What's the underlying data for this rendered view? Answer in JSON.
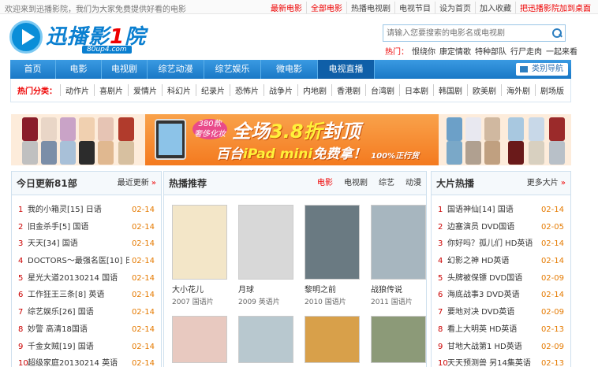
{
  "topbar": {
    "welcome": "欢迎来到迅播影院，我们为大家免费提供好看的电影",
    "links": [
      {
        "label": "最新电影",
        "color": "red"
      },
      {
        "label": "全部电影",
        "color": "red"
      },
      {
        "label": "热播电视剧",
        "color": "dark"
      },
      {
        "label": "电视节目",
        "color": "dark"
      },
      {
        "label": "设为首页",
        "color": "dark"
      },
      {
        "label": "加入收藏",
        "color": "dark"
      },
      {
        "label": "把迅播影院加到桌面",
        "color": "red"
      }
    ]
  },
  "logo": {
    "name_a": "迅播影",
    "name_one": "1",
    "name_b": "院",
    "sub": "80up4.com"
  },
  "search": {
    "placeholder": "请输入您要搜索的电影名或电视剧"
  },
  "hot": {
    "label": "热门：",
    "items": [
      "恨绕你",
      "康定情歌",
      "特种部队",
      "行尸走肉",
      "一起来看"
    ]
  },
  "nav": {
    "items": [
      "首页",
      "电影",
      "电视剧",
      "综艺动漫",
      "综艺娱乐",
      "微电影",
      "电视直播"
    ],
    "active_index": 6,
    "menu_label": "类别导航"
  },
  "subnav": {
    "label": "热门分类：",
    "items": [
      "动作片",
      "喜剧片",
      "爱情片",
      "科幻片",
      "纪录片",
      "恐怖片",
      "战争片",
      "内地剧",
      "香港剧",
      "台湾剧",
      "日本剧",
      "韩国剧",
      "欧美剧",
      "海外剧",
      "剧场版"
    ]
  },
  "banner": {
    "tag_line1": "380款",
    "tag_line2": "奢侈化妆",
    "headline_a": "全场",
    "headline_num": "3.8折",
    "headline_b": "封顶",
    "subline_a": "百台",
    "subline_b": "iPad mini",
    "subline_c": "免费拿！",
    "auth": "100%正行货"
  },
  "left_col": {
    "title": "今日更新81部",
    "more": "最近更新",
    "items": [
      {
        "n": "1",
        "title": "我的小箱灵[15] 日语",
        "date": "02-14"
      },
      {
        "n": "2",
        "title": "旧金杀手[5] 国语",
        "date": "02-14"
      },
      {
        "n": "3",
        "title": "天天[34] 国语",
        "date": "02-14"
      },
      {
        "n": "4",
        "title": "DOCTORS～最强名医[10] 日语",
        "date": "02-14"
      },
      {
        "n": "5",
        "title": "星光大道20130214 国语",
        "date": "02-14"
      },
      {
        "n": "6",
        "title": "工作狂王三条[8] 英语",
        "date": "02-14"
      },
      {
        "n": "7",
        "title": "综艺娱乐[26] 国语",
        "date": "02-14"
      },
      {
        "n": "8",
        "title": "妙警 高清18国语",
        "date": "02-14"
      },
      {
        "n": "9",
        "title": "千金女贼[19] 国语",
        "date": "02-14"
      },
      {
        "n": "10",
        "title": "超级家庭20130214 英语",
        "date": "02-14"
      }
    ]
  },
  "mid_col": {
    "title": "热播推荐",
    "tabs": [
      "电影",
      "电视剧",
      "综艺",
      "动漫"
    ],
    "active_tab": 0,
    "movies_row1": [
      {
        "title": "大小花儿",
        "info": "2007 国语片",
        "bg": "#f3e6c8"
      },
      {
        "title": "月球",
        "info": "2009 英语片",
        "bg": "#d8d8d8"
      },
      {
        "title": "黎明之前",
        "info": "2010 国语片",
        "bg": "#6a7a82"
      },
      {
        "title": "战狼传说",
        "info": "2011 国语片",
        "bg": "#a7b6bf"
      }
    ],
    "movies_row2": [
      {
        "bg": "#e8c9c0"
      },
      {
        "bg": "#b8c8cf"
      },
      {
        "bg": "#d8a04a"
      },
      {
        "bg": "#8c9a78"
      }
    ]
  },
  "right_col": {
    "title": "大片热播",
    "more": "更多大片",
    "items": [
      {
        "n": "1",
        "title": "国语神仙[14] 国语",
        "date": "02-14"
      },
      {
        "n": "2",
        "title": "边塞演员 DVD国语",
        "date": "02-05"
      },
      {
        "n": "3",
        "title": "你好吗？孤儿们 HD英语",
        "date": "02-14"
      },
      {
        "n": "4",
        "title": "幻影之神 HD英语",
        "date": "02-14"
      },
      {
        "n": "5",
        "title": "头牌被保镖 DVD国语",
        "date": "02-09"
      },
      {
        "n": "6",
        "title": "海底战事3 DVD英语",
        "date": "02-14"
      },
      {
        "n": "7",
        "title": "要地对决 DVD英语",
        "date": "02-09"
      },
      {
        "n": "8",
        "title": "看上大明英 HD英语",
        "date": "02-13"
      },
      {
        "n": "9",
        "title": "甘地大战第1 HD英语",
        "date": "02-09"
      },
      {
        "n": "10",
        "title": "天天预测兽 另14集英语",
        "date": "02-13"
      }
    ]
  }
}
